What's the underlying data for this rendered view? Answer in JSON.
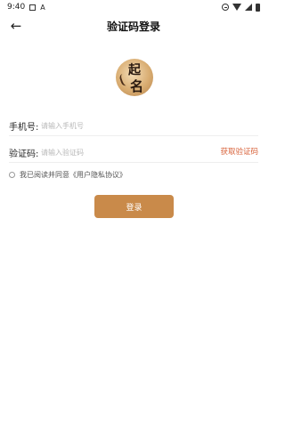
{
  "status_bar": {
    "time": "9:40",
    "left_icons": [
      "image-icon",
      "a-icon"
    ],
    "right_icons": [
      "do-not-disturb-icon",
      "wifi-icon",
      "signal-icon",
      "battery-icon"
    ]
  },
  "header": {
    "back_icon": "arrow-left-icon",
    "title": "验证码登录"
  },
  "logo": {
    "chars": [
      "起",
      "名"
    ],
    "colors": {
      "light": "#f3dcb6",
      "mid": "#d9ad72",
      "dark": "#b7824a"
    }
  },
  "form": {
    "phone": {
      "label": "手机号:",
      "value": "",
      "placeholder": "请输入手机号"
    },
    "code": {
      "label": "验证码:",
      "value": "",
      "placeholder": "请输入验证码"
    },
    "get_code_label": "获取验证码",
    "agreement_text": "我已阅读并同意《用户隐私协议》",
    "agreement_checked": false,
    "login_label": "登录"
  },
  "colors": {
    "accent": "#c98a4a",
    "link": "#d8623a",
    "placeholder": "#b8b8b8"
  }
}
